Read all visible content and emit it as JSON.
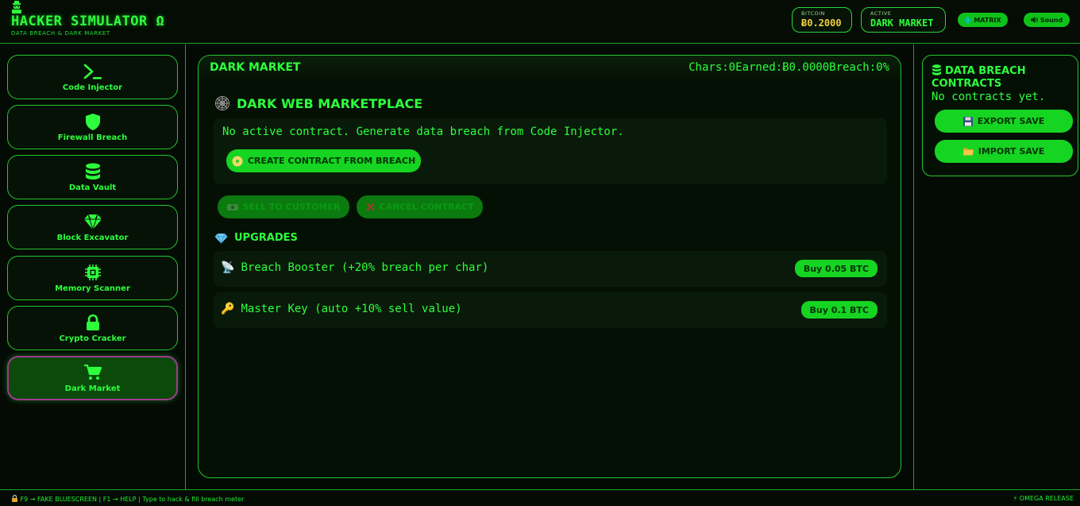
{
  "header": {
    "title": "HACKER SIMULATOR Ω",
    "subtitle": "DATA BREACH & DARK MARKET",
    "bitcoin": {
      "label": "BITCOIN",
      "value": "Ƀ0.2000"
    },
    "active": {
      "label": "ACTIVE",
      "value": "DARK MARKET"
    },
    "matrix_label": "MATRIX",
    "sound_label": "Sound"
  },
  "sidebar": {
    "items": [
      {
        "label": "Code Injector",
        "icon": "terminal-icon"
      },
      {
        "label": "Firewall Breach",
        "icon": "shield-icon"
      },
      {
        "label": "Data Vault",
        "icon": "database-icon"
      },
      {
        "label": "Block Excavator",
        "icon": "gem-icon"
      },
      {
        "label": "Memory Scanner",
        "icon": "chip-icon"
      },
      {
        "label": "Crypto Cracker",
        "icon": "lock-icon"
      },
      {
        "label": "Dark Market",
        "icon": "cart-icon",
        "active": true
      }
    ]
  },
  "main": {
    "title": "DARK MARKET",
    "stats": {
      "chars": "Chars:0",
      "earned": "Earned:Ƀ0.0000",
      "breach": "Breach:0%"
    },
    "marketplace_title": "DARK WEB MARKETPLACE",
    "contract_message": "No active contract. Generate data breach from Code Injector.",
    "create_contract_label": "CREATE CONTRACT FROM BREACH",
    "sell_label": "SELL TO CUSTOMER",
    "cancel_label": "CANCEL CONTRACT",
    "upgrades_title": "UPGRADES",
    "upgrades": [
      {
        "name": "Breach Booster (+20% breach per char)",
        "buy": "Buy 0.05 BTC",
        "emoji": "📡"
      },
      {
        "name": "Master Key (auto +10% sell value)",
        "buy": "Buy 0.1 BTC",
        "emoji": "🔑"
      }
    ]
  },
  "right": {
    "title": "DATA BREACH CONTRACTS",
    "empty": "No contracts yet.",
    "export_label": "EXPORT SAVE",
    "import_label": "IMPORT SAVE"
  },
  "footer": {
    "left": "F9 → FAKE BLUESCREEN | F1 → HELP | Type to hack & fill breach meter",
    "right": "⚡ OMEGA RELEASE"
  },
  "colors": {
    "accent": "#22ff33",
    "background": "#030a03",
    "gold": "#f2cf3a"
  }
}
